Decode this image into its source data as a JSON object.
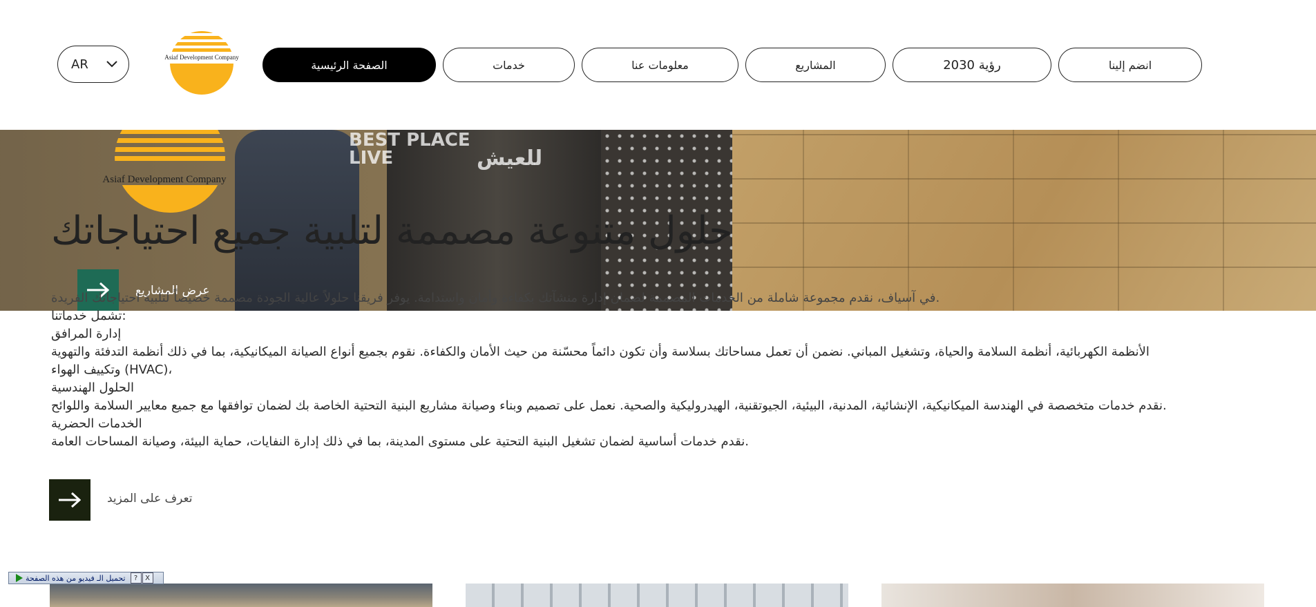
{
  "header": {
    "language": "AR",
    "logo_caption": "Asiaf Development Company",
    "nav": [
      {
        "label": "الصفحة الرئيسية",
        "active": true
      },
      {
        "label": "خدمات",
        "active": false
      },
      {
        "label": "معلومات عنا",
        "active": false
      },
      {
        "label": "المشاريع",
        "active": false
      },
      {
        "label": "رؤية 2030",
        "active": false
      },
      {
        "label": "انضم إلينا",
        "active": false
      }
    ]
  },
  "hero": {
    "logo_caption": "Asiaf Development Company",
    "title": "حلول متنوعة مصممة لتلبية جميع احتياجاتك",
    "cta_label": "عرض المشاريع",
    "background_text": [
      "BEST PLACE",
      "LIVE",
      "للعيش"
    ]
  },
  "content": {
    "paragraphs": [
      "في آسياف، نقدم مجموعة شاملة من الخدمات المصممة لضمان إدارة منشآتك بكفاءة وأمان واستدامة. يوفر فريقنا حلولاً عالية الجودة مصممة خصيصاً لتلبية احتياجاتك الفريدة.",
      "تشمل خدماتنا:",
      "إدارة المرافق",
      "الأنظمة الكهربائية، أنظمة السلامة والحياة، وتشغيل المباني. نضمن أن تعمل مساحاتك بسلاسة وأن تكون دائماً محسّنة من حيث الأمان والكفاءة. نقوم بجميع أنواع الصيانة الميكانيكية، بما في ذلك أنظمة التدفئة والتهوية وتكييف الهواء (HVAC)،",
      "الحلول الهندسية",
      "نقدم خدمات متخصصة في الهندسة الميكانيكية، الإنشائية، المدنية، البيئية، الجيوتقنية، الهيدروليكية والصحية. نعمل على تصميم وبناء وصيانة مشاريع البنية التحتية الخاصة بك لضمان توافقها مع جميع معايير السلامة واللوائح.",
      "الخدمات الحضرية",
      "نقدم خدمات أساسية لضمان تشغيل البنية التحتية على مستوى المدينة، بما في ذلك إدارة النفايات، حماية البيئة، وصيانة المساحات العامة."
    ],
    "cta_label": "تعرف على المزيد"
  },
  "video_bar": {
    "label": "تحميل الـ فيديو من هذه الصفحة",
    "help": "?",
    "close": "X"
  },
  "colors": {
    "accent": "#f9b21c",
    "dark_green": "#1a220f",
    "teal": "#1e6b55"
  }
}
